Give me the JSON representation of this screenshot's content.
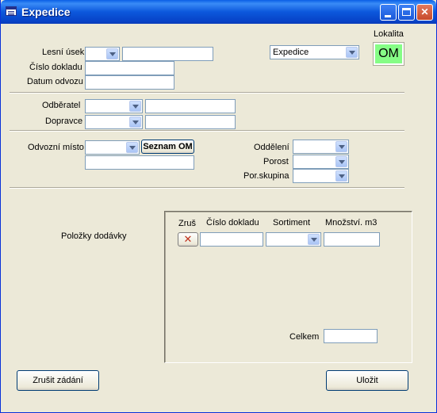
{
  "window": {
    "title": "Expedice"
  },
  "lokalita": {
    "label": "Lokalita",
    "value": "OM",
    "color": "#86fd86"
  },
  "form": {
    "lesni_usek_label": "Lesní úsek",
    "cislo_dokladu_label": "Číslo dokladu",
    "datum_odvozu_label": "Datum odvozu",
    "expedice_value": "Expedice",
    "odberatel_label": "Odběratel",
    "dopravce_label": "Dopravce",
    "odvozni_misto_label": "Odvozní místo",
    "seznam_om_label": "Seznam OM",
    "oddeleni_label": "Oddělení",
    "porost_label": "Porost",
    "por_skupina_label": "Por.skupina"
  },
  "items": {
    "section_label": "Položky dodávky",
    "col_zrus": "Zruš",
    "col_cislo_dokladu": "Číslo dokladu",
    "col_sortiment": "Sortiment",
    "col_mnozstvi": "Množství. m3",
    "celkem_label": "Celkem"
  },
  "buttons": {
    "cancel_label": "Zrušit zádání",
    "save_label": "Uložit"
  }
}
